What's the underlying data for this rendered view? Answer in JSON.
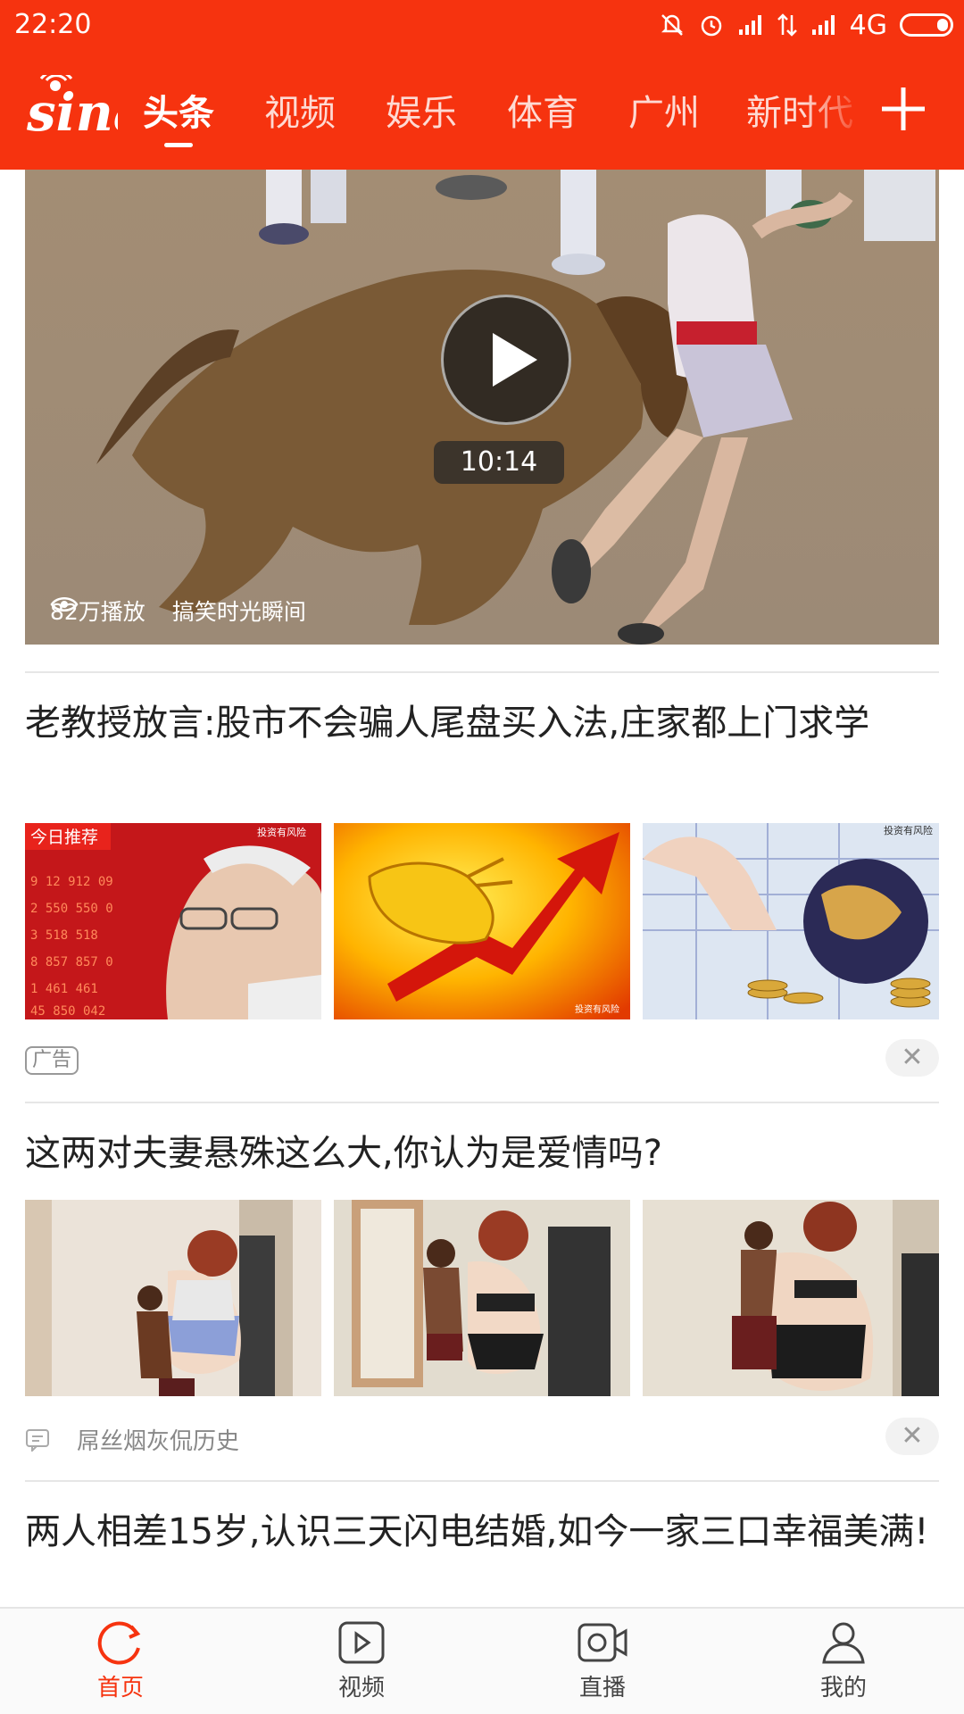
{
  "status_bar": {
    "time": "22:20",
    "network": "4G",
    "icons": [
      "mute-bell-icon",
      "alarm-icon",
      "signal-icon",
      "data-arrows-icon",
      "signal-icon",
      "battery-icon"
    ]
  },
  "header": {
    "logo_text": "sina",
    "tabs": [
      "头条",
      "视频",
      "娱乐",
      "体育",
      "广州",
      "新时代"
    ],
    "active_tab": "头条",
    "add_icon": "plus-icon"
  },
  "video_card": {
    "duration": "10:14",
    "play_count": "82万播放",
    "source": "搞笑时光瞬间"
  },
  "articles": [
    {
      "title": "老教授放言:股市不会骗人尾盘买入法,庄家都上门求学",
      "thumbs": [
        {
          "overlay_tag": "今日推荐",
          "watermark": "投资有风险"
        },
        {
          "watermark": "投资有风险"
        },
        {
          "watermark": "投资有风险"
        }
      ],
      "badge": "广告",
      "close": "✕"
    },
    {
      "title": "这两对夫妻悬殊这么大,你认为是爱情吗?",
      "source": "屌丝烟灰侃历史",
      "close": "✕"
    },
    {
      "title": "两人相差15岁,认识三天闪电结婚,如今一家三口幸福美满!"
    }
  ],
  "bottom_nav": [
    {
      "label": "首页",
      "icon": "refresh-home-icon",
      "active": true
    },
    {
      "label": "视频",
      "icon": "video-play-icon",
      "active": false
    },
    {
      "label": "直播",
      "icon": "live-camera-icon",
      "active": false
    },
    {
      "label": "我的",
      "icon": "user-icon",
      "active": false
    }
  ],
  "colors": {
    "brand_red": "#f6330f",
    "text_dark": "#222222",
    "text_gray": "#888888"
  }
}
